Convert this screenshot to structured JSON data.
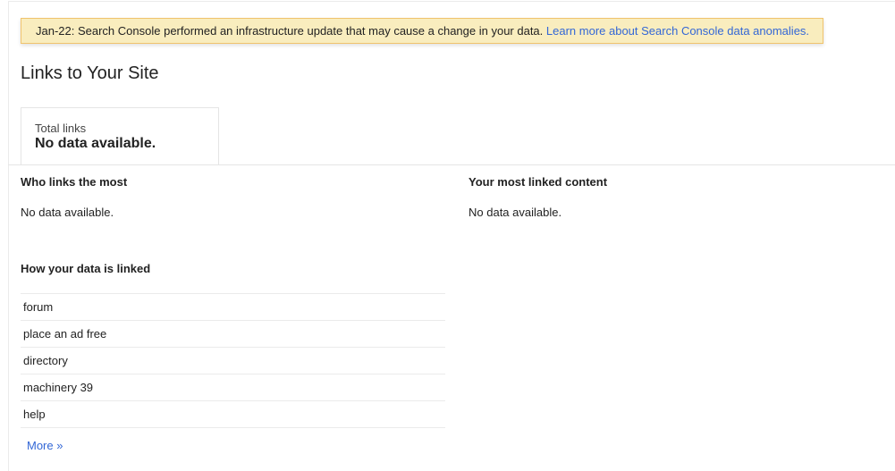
{
  "banner": {
    "message": "Jan-22: Search Console performed an infrastructure update that may cause a change in your data.",
    "link_text": "Learn more about Search Console data anomalies."
  },
  "page_title": "Links to Your Site",
  "total_links": {
    "label": "Total links",
    "value": "No data available."
  },
  "who_links_most": {
    "heading": "Who links the most",
    "status": "No data available."
  },
  "most_linked_content": {
    "heading": "Your most linked content",
    "status": "No data available."
  },
  "how_data_linked": {
    "heading": "How your data is linked",
    "items": [
      "forum",
      "place an ad free",
      "directory",
      "machinery 39",
      "help"
    ],
    "more_label": "More »"
  }
}
